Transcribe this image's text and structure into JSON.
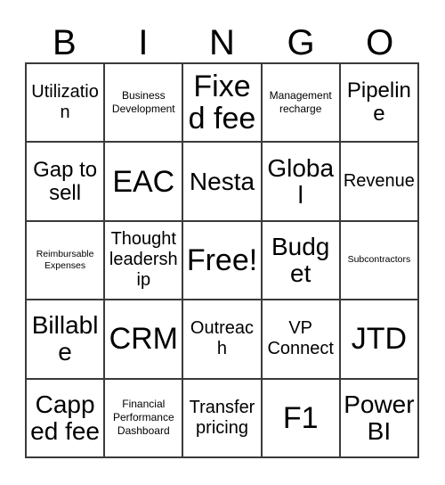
{
  "card": {
    "header_letters": [
      "B",
      "I",
      "N",
      "G",
      "O"
    ],
    "free_space_label": "Free!",
    "text_color": "#000000",
    "border_color": "#3a3a3a",
    "background_color": "#ffffff",
    "rows": [
      [
        {
          "label": "Utilization",
          "size": "md"
        },
        {
          "label": "Business Development",
          "size": "xs"
        },
        {
          "label": "Fixed fee",
          "size": "xxl"
        },
        {
          "label": "Management recharge",
          "size": "xs"
        },
        {
          "label": "Pipeline",
          "size": "lg"
        }
      ],
      [
        {
          "label": "Gap to sell",
          "size": "lg"
        },
        {
          "label": "EAC",
          "size": "xxl"
        },
        {
          "label": "Nesta",
          "size": "xl"
        },
        {
          "label": "Global",
          "size": "xl"
        },
        {
          "label": "Revenue",
          "size": "md"
        }
      ],
      [
        {
          "label": "Reimbursable Expenses",
          "size": "xxs"
        },
        {
          "label": "Thought leadership",
          "size": "md"
        },
        {
          "label": "Free!",
          "size": "xxl"
        },
        {
          "label": "Budget",
          "size": "xl"
        },
        {
          "label": "Subcontractors",
          "size": "xxs"
        }
      ],
      [
        {
          "label": "Billable",
          "size": "xl"
        },
        {
          "label": "CRM",
          "size": "xxl"
        },
        {
          "label": "Outreach",
          "size": "md"
        },
        {
          "label": "VP Connect",
          "size": "md"
        },
        {
          "label": "JTD",
          "size": "xxl"
        }
      ],
      [
        {
          "label": "Capped fee",
          "size": "xl"
        },
        {
          "label": "Financial Performance Dashboard",
          "size": "xs"
        },
        {
          "label": "Transfer pricing",
          "size": "md"
        },
        {
          "label": "F1",
          "size": "xxl"
        },
        {
          "label": "Power BI",
          "size": "xl"
        }
      ]
    ]
  }
}
